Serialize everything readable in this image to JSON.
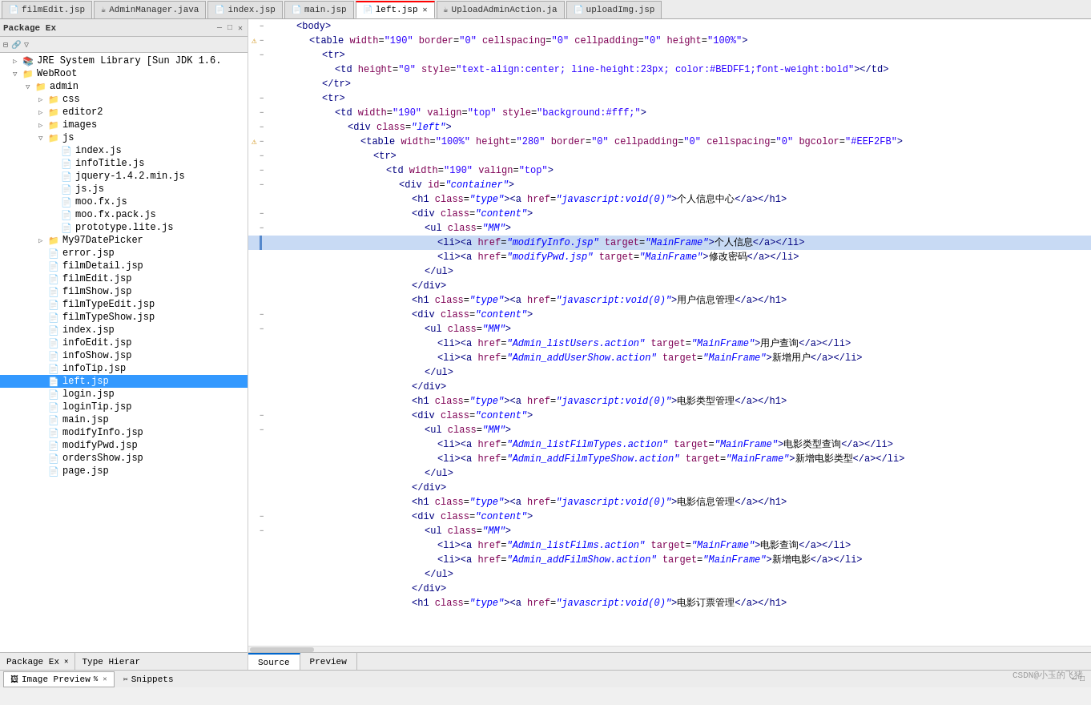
{
  "tabs": [
    {
      "id": "tab-filmEdit",
      "label": "filmEdit.jsp",
      "icon": "📄",
      "active": false,
      "closable": false
    },
    {
      "id": "tab-adminManager",
      "label": "AdminManager.java",
      "icon": "☕",
      "active": false,
      "closable": false
    },
    {
      "id": "tab-index",
      "label": "index.jsp",
      "icon": "📄",
      "active": false,
      "closable": false
    },
    {
      "id": "tab-main",
      "label": "main.jsp",
      "icon": "📄",
      "active": false,
      "closable": false
    },
    {
      "id": "tab-left",
      "label": "left.jsp",
      "icon": "📄",
      "active": true,
      "closable": true
    },
    {
      "id": "tab-uploadAdmin",
      "label": "UploadAdminAction.ja",
      "icon": "☕",
      "active": false,
      "closable": false
    },
    {
      "id": "tab-uploadImg",
      "label": "uploadImg.jsp",
      "icon": "📄",
      "active": false,
      "closable": false
    }
  ],
  "tree": {
    "items": [
      {
        "id": "package-ex",
        "label": "Package Ex",
        "indent": 0,
        "icon": "pkg",
        "expanded": true
      },
      {
        "id": "jre",
        "label": "JRE System Library [Sun JDK 1.6.",
        "indent": 1,
        "icon": "library",
        "expanded": false
      },
      {
        "id": "webroot",
        "label": "WebRoot",
        "indent": 1,
        "icon": "folder",
        "expanded": true
      },
      {
        "id": "admin",
        "label": "admin",
        "indent": 2,
        "icon": "folder",
        "expanded": true
      },
      {
        "id": "css",
        "label": "css",
        "indent": 3,
        "icon": "folder",
        "expanded": false
      },
      {
        "id": "editor2",
        "label": "editor2",
        "indent": 3,
        "icon": "folder",
        "expanded": false
      },
      {
        "id": "images",
        "label": "images",
        "indent": 3,
        "icon": "folder",
        "expanded": false
      },
      {
        "id": "js",
        "label": "js",
        "indent": 3,
        "icon": "folder",
        "expanded": true
      },
      {
        "id": "index-js",
        "label": "index.js",
        "indent": 4,
        "icon": "file",
        "expanded": false
      },
      {
        "id": "infoTitle-js",
        "label": "infoTitle.js",
        "indent": 4,
        "icon": "file",
        "expanded": false
      },
      {
        "id": "jquery",
        "label": "jquery-1.4.2.min.js",
        "indent": 4,
        "icon": "file",
        "expanded": false
      },
      {
        "id": "js-js",
        "label": "js.js",
        "indent": 4,
        "icon": "file",
        "expanded": false
      },
      {
        "id": "moo-fx",
        "label": "moo.fx.js",
        "indent": 4,
        "icon": "file",
        "expanded": false
      },
      {
        "id": "moo-fx-pack",
        "label": "moo.fx.pack.js",
        "indent": 4,
        "icon": "file",
        "expanded": false
      },
      {
        "id": "prototype",
        "label": "prototype.lite.js",
        "indent": 4,
        "icon": "file",
        "expanded": false
      },
      {
        "id": "my97",
        "label": "My97DatePicker",
        "indent": 3,
        "icon": "folder",
        "expanded": false
      },
      {
        "id": "error-jsp",
        "label": "error.jsp",
        "indent": 3,
        "icon": "jsp",
        "expanded": false
      },
      {
        "id": "filmDetail-jsp",
        "label": "filmDetail.jsp",
        "indent": 3,
        "icon": "jsp",
        "expanded": false
      },
      {
        "id": "filmEdit-jsp",
        "label": "filmEdit.jsp",
        "indent": 3,
        "icon": "jsp",
        "expanded": false
      },
      {
        "id": "filmShow-jsp",
        "label": "filmShow.jsp",
        "indent": 3,
        "icon": "jsp",
        "expanded": false
      },
      {
        "id": "filmTypeEdit-jsp",
        "label": "filmTypeEdit.jsp",
        "indent": 3,
        "icon": "jsp",
        "expanded": false
      },
      {
        "id": "filmTypeShow-jsp",
        "label": "filmTypeShow.jsp",
        "indent": 3,
        "icon": "jsp",
        "expanded": false
      },
      {
        "id": "index-jsp",
        "label": "index.jsp",
        "indent": 3,
        "icon": "jsp",
        "expanded": false
      },
      {
        "id": "infoEdit-jsp",
        "label": "infoEdit.jsp",
        "indent": 3,
        "icon": "jsp",
        "expanded": false
      },
      {
        "id": "infoShow-jsp",
        "label": "infoShow.jsp",
        "indent": 3,
        "icon": "jsp",
        "expanded": false
      },
      {
        "id": "infoTip-jsp",
        "label": "infoTip.jsp",
        "indent": 3,
        "icon": "jsp",
        "expanded": false
      },
      {
        "id": "left-jsp",
        "label": "left.jsp",
        "indent": 3,
        "icon": "jsp",
        "selected": true,
        "expanded": false
      },
      {
        "id": "login-jsp",
        "label": "login.jsp",
        "indent": 3,
        "icon": "jsp",
        "expanded": false
      },
      {
        "id": "loginTip-jsp",
        "label": "loginTip.jsp",
        "indent": 3,
        "icon": "jsp",
        "expanded": false
      },
      {
        "id": "main-jsp",
        "label": "main.jsp",
        "indent": 3,
        "icon": "jsp",
        "expanded": false
      },
      {
        "id": "modifyInfo-jsp",
        "label": "modifyInfo.jsp",
        "indent": 3,
        "icon": "jsp",
        "expanded": false
      },
      {
        "id": "modifyPwd-jsp",
        "label": "modifyPwd.jsp",
        "indent": 3,
        "icon": "jsp",
        "expanded": false
      },
      {
        "id": "ordersShow-jsp",
        "label": "ordersShow.jsp",
        "indent": 3,
        "icon": "jsp",
        "expanded": false
      },
      {
        "id": "page-jsp",
        "label": "page.jsp",
        "indent": 3,
        "icon": "jsp",
        "expanded": false
      }
    ]
  },
  "code_lines": [
    {
      "indent": 1,
      "content": "<body>",
      "type": "tag",
      "marker": "",
      "collapse": "minus"
    },
    {
      "indent": 2,
      "content": "<table width=\"190\" border=\"0\" cellspacing=\"0\" cellpadding=\"0\" height=\"100%\">",
      "type": "tag",
      "marker": "warn",
      "collapse": "minus"
    },
    {
      "indent": 3,
      "content": "<tr>",
      "type": "tag",
      "marker": "",
      "collapse": "minus"
    },
    {
      "indent": 4,
      "content": "<td height=\"0\" style=\"text-align:center; line-height:23px; color:#BEDFF1;font-weight:bold\"></td>",
      "type": "tag",
      "marker": "",
      "collapse": ""
    },
    {
      "indent": 3,
      "content": "</tr>",
      "type": "tag",
      "marker": "",
      "collapse": ""
    },
    {
      "indent": 3,
      "content": "<tr>",
      "type": "tag",
      "marker": "",
      "collapse": "minus"
    },
    {
      "indent": 4,
      "content": "<td width=\"190\" valign=\"top\" style=\"background:#fff;\">",
      "type": "tag",
      "marker": "",
      "collapse": "minus"
    },
    {
      "indent": 5,
      "content": "<div class=\"left\">",
      "type": "tag",
      "marker": "",
      "collapse": "minus"
    },
    {
      "indent": 6,
      "content": "<table width=\"100%\" height=\"280\" border=\"0\" cellpadding=\"0\" cellspacing=\"0\" bgcolor=\"#EEF2FB\">",
      "type": "tag",
      "marker": "warn",
      "collapse": "minus"
    },
    {
      "indent": 7,
      "content": "<tr>",
      "type": "tag",
      "marker": "",
      "collapse": "minus"
    },
    {
      "indent": 8,
      "content": "<td width=\"190\" valign=\"top\">",
      "type": "tag",
      "marker": "",
      "collapse": "minus"
    },
    {
      "indent": 9,
      "content": "<div id=\"container\">",
      "type": "tag",
      "marker": "",
      "collapse": "minus"
    },
    {
      "indent": 10,
      "content": "<h1 class=\"type\"><a href=\"javascript:void(0)\">个人信息中心</a></h1>",
      "type": "tag",
      "marker": "",
      "collapse": ""
    },
    {
      "indent": 10,
      "content": "<div class=\"content\">",
      "type": "tag",
      "marker": "",
      "collapse": "minus"
    },
    {
      "indent": 11,
      "content": "<ul class=\"MM\">",
      "type": "tag",
      "marker": "",
      "collapse": "minus"
    },
    {
      "indent": 12,
      "content": "<li><a href=\"modifyInfo.jsp\" target=\"MainFrame\">个人信息</a></li>",
      "type": "tag_highlighted",
      "marker": "",
      "collapse": ""
    },
    {
      "indent": 12,
      "content": "<li><a href=\"modifyPwd.jsp\" target=\"MainFrame\">修改密码</a></li>",
      "type": "tag",
      "marker": "",
      "collapse": ""
    },
    {
      "indent": 11,
      "content": "</ul>",
      "type": "tag",
      "marker": "",
      "collapse": ""
    },
    {
      "indent": 10,
      "content": "</div>",
      "type": "tag",
      "marker": "",
      "collapse": ""
    },
    {
      "indent": 10,
      "content": "<h1 class=\"type\"><a href=\"javascript:void(0)\">用户信息管理</a></h1>",
      "type": "tag",
      "marker": "",
      "collapse": ""
    },
    {
      "indent": 10,
      "content": "<div class=\"content\">",
      "type": "tag",
      "marker": "",
      "collapse": "minus"
    },
    {
      "indent": 11,
      "content": "<ul class=\"MM\">",
      "type": "tag",
      "marker": "",
      "collapse": "minus"
    },
    {
      "indent": 12,
      "content": "<li><a href=\"Admin_listUsers.action\" target=\"MainFrame\">用户查询</a></li>",
      "type": "tag",
      "marker": "",
      "collapse": ""
    },
    {
      "indent": 12,
      "content": "<li><a href=\"Admin_addUserShow.action\" target=\"MainFrame\">新增用户</a></li>",
      "type": "tag",
      "marker": "",
      "collapse": ""
    },
    {
      "indent": 11,
      "content": "</ul>",
      "type": "tag",
      "marker": "",
      "collapse": ""
    },
    {
      "indent": 10,
      "content": "</div>",
      "type": "tag",
      "marker": "",
      "collapse": ""
    },
    {
      "indent": 10,
      "content": "<h1 class=\"type\"><a href=\"javascript:void(0)\">电影类型管理</a></h1>",
      "type": "tag",
      "marker": "",
      "collapse": ""
    },
    {
      "indent": 10,
      "content": "<div class=\"content\">",
      "type": "tag",
      "marker": "",
      "collapse": "minus"
    },
    {
      "indent": 11,
      "content": "<ul class=\"MM\">",
      "type": "tag",
      "marker": "",
      "collapse": "minus"
    },
    {
      "indent": 12,
      "content": "<li><a href=\"Admin_listFilmTypes.action\" target=\"MainFrame\">电影类型查询</a></li>",
      "type": "tag",
      "marker": "",
      "collapse": ""
    },
    {
      "indent": 12,
      "content": "<li><a href=\"Admin_addFilmTypeShow.action\" target=\"MainFrame\">新增电影类型</a></li>",
      "type": "tag",
      "marker": "",
      "collapse": ""
    },
    {
      "indent": 11,
      "content": "</ul>",
      "type": "tag",
      "marker": "",
      "collapse": ""
    },
    {
      "indent": 10,
      "content": "</div>",
      "type": "tag",
      "marker": "",
      "collapse": ""
    },
    {
      "indent": 10,
      "content": "<h1 class=\"type\"><a href=\"javascript:void(0)\">电影信息管理</a></h1>",
      "type": "tag",
      "marker": "",
      "collapse": ""
    },
    {
      "indent": 10,
      "content": "<div class=\"content\">",
      "type": "tag",
      "marker": "",
      "collapse": "minus"
    },
    {
      "indent": 11,
      "content": "<ul class=\"MM\">",
      "type": "tag",
      "marker": "",
      "collapse": "minus"
    },
    {
      "indent": 12,
      "content": "<li><a href=\"Admin_listFilms.action\" target=\"MainFrame\">电影查询</a></li>",
      "type": "tag",
      "marker": "",
      "collapse": ""
    },
    {
      "indent": 12,
      "content": "<li><a href=\"Admin_addFilmShow.action\" target=\"MainFrame\">新增电影</a></li>",
      "type": "tag",
      "marker": "",
      "collapse": ""
    },
    {
      "indent": 11,
      "content": "</ul>",
      "type": "tag",
      "marker": "",
      "collapse": ""
    },
    {
      "indent": 10,
      "content": "</div>",
      "type": "tag",
      "marker": "",
      "collapse": ""
    },
    {
      "indent": 10,
      "content": "<h1 class=\"type\"><a href=\"javascript:void(0)\">电影订票管理</a></h1>",
      "type": "tag",
      "marker": "",
      "collapse": ""
    }
  ],
  "bottom_tabs": [
    {
      "id": "image-preview",
      "label": "Image Preview",
      "icon": "🖼",
      "active": true,
      "closable": true
    },
    {
      "id": "snippets",
      "label": "Snippets",
      "icon": "✂",
      "active": false,
      "closable": false
    }
  ],
  "source_preview_tabs": [
    {
      "id": "source",
      "label": "Source",
      "active": true
    },
    {
      "id": "preview",
      "label": "Preview",
      "active": false
    }
  ],
  "watermark": "CSDN@小玉的飞猪",
  "status": {
    "image_preview_label": "Image Preview %"
  }
}
